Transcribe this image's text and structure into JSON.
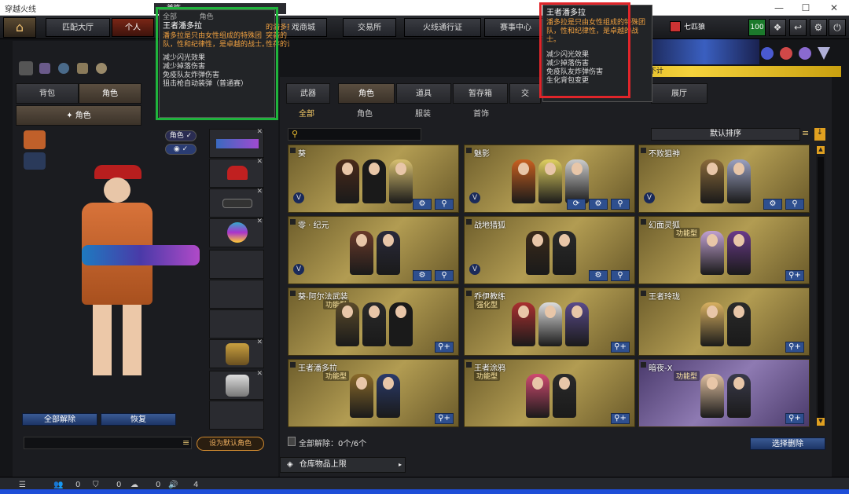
{
  "window": {
    "title": "穿越火线"
  },
  "nav": {
    "tabs": [
      "匹配大厅",
      "个人",
      "首饰",
      "戏商城",
      "交易所",
      "火线通行证",
      "赛事中心"
    ],
    "clan": "七匹狼",
    "level": "100"
  },
  "left": {
    "tabs": [
      "背包",
      "角色"
    ],
    "subtab": "角色",
    "toggle_label": "角色",
    "buttons": {
      "clear_all": "全部解除",
      "restore": "恢复",
      "set_default": "设为默认角色"
    }
  },
  "main": {
    "tabs": [
      "武器",
      "角色",
      "道具",
      "暂存箱",
      "交",
      "展厅"
    ],
    "subtabs": [
      "全部",
      "角色",
      "服装",
      "首饰"
    ],
    "sort_label": "默认排序",
    "status": "全部解除：0个/6个",
    "select_remove": "选择删除",
    "storage_limit": "仓库物品上限"
  },
  "cards": [
    {
      "name": "葵",
      "tag": ""
    },
    {
      "name": "魅影",
      "tag": ""
    },
    {
      "name": "不败狙神",
      "tag": ""
    },
    {
      "name": "零 · 纪元",
      "tag": ""
    },
    {
      "name": "战地猎狐",
      "tag": ""
    },
    {
      "name": "幻面灵狐",
      "tag": "功能型"
    },
    {
      "name": "葵-阿尔法武装",
      "tag": "功能型"
    },
    {
      "name": "乔伊教练",
      "tag": "强化型"
    },
    {
      "name": "王者玲珑",
      "tag": ""
    },
    {
      "name": "王者潘多拉",
      "tag": "功能型"
    },
    {
      "name": "王者涂鸦",
      "tag": "功能型"
    },
    {
      "name": "暗夜-X",
      "tag": "功能型"
    }
  ],
  "tooltip_left": {
    "header_tabs": [
      "首饰",
      "全部",
      "角色"
    ],
    "title": "王者潘多拉",
    "desc": "潘多拉是只由女性组成的特殊团队，性和纪律性，是卓越的战士。",
    "overflow": "的潘多拉\n突袭的\n性存的让",
    "effects": [
      "减少闪光效果",
      "减少掉落伤害",
      "免疫队友炸弹伤害",
      "狙击枪自动装弹（普通赛）"
    ]
  },
  "tooltip_right": {
    "title": "王者潘多拉",
    "desc": "潘多拉是只由女性组成的特殊团队，性和纪律性，是卓越的战士。",
    "effects": [
      "减少闪光效果",
      "减少掉落伤害",
      "免疫队友炸弹伤害",
      "生化背包变更"
    ],
    "banner_text": "不计"
  },
  "bottom": {
    "counts": [
      "0",
      "0",
      "0",
      "0",
      "4"
    ]
  },
  "colors": {
    "highlight": "#1fb43c",
    "highlight_red": "#e0252a"
  }
}
